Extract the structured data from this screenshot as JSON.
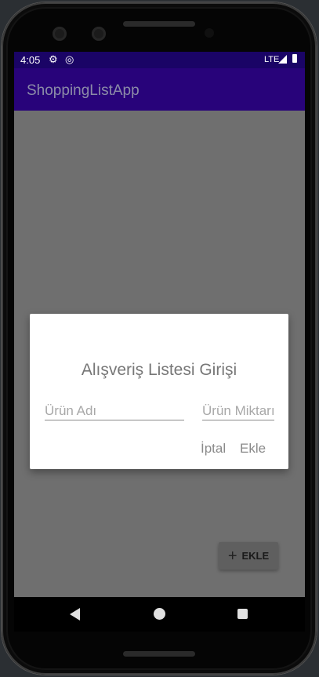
{
  "status_bar": {
    "time": "4:05",
    "settings_icon": "gear-icon",
    "sync_icon": "data-saver-icon",
    "network": "LTE"
  },
  "app_bar": {
    "title": "ShoppingListApp"
  },
  "dialog": {
    "title": "Alışveriş Listesi Girişi",
    "item_name_placeholder": "Ürün Adı",
    "item_quantity_placeholder": "Ürün Miktarı",
    "cancel_label": "İptal",
    "confirm_label": "Ekle"
  },
  "fab": {
    "label": "EKLE",
    "icon": "plus-icon"
  },
  "colors": {
    "status_bar": "#1a0466",
    "app_bar": "#28037a",
    "scrim": "#6f6f6f",
    "dialog_bg": "#ffffff"
  }
}
